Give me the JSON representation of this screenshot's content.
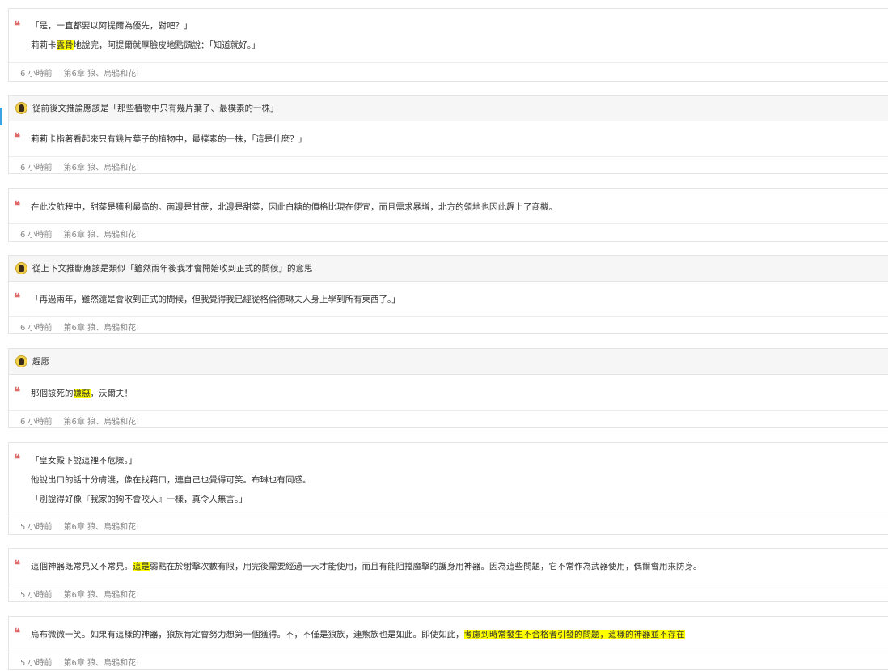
{
  "entries": [
    {
      "lines": [
        [
          {
            "t": "「是，一直都要以阿提爾為優先，對吧？」"
          }
        ],
        [
          {
            "t": "莉莉卡"
          },
          {
            "t": "露骨",
            "hl": true
          },
          {
            "t": "地說完，阿提爾就厚臉皮地點頭說：「知道就好。」"
          }
        ]
      ],
      "time": "6 小時前",
      "chapter": "第6章 狼、烏鴉和花I"
    },
    {
      "note": "從前後文推論應該是「那些植物中只有幾片葉子、最樸素的一株」",
      "lines": [
        [
          {
            "t": "莉莉卡指著看起來只有幾片葉子的植物中，最樸素的一株，「這是什麼？」"
          }
        ]
      ],
      "time": "6 小時前",
      "chapter": "第6章 狼、烏鴉和花I"
    },
    {
      "lines": [
        [
          {
            "t": "在此次航程中，甜菜是獲利最高的。南邊是甘蔗，北邊是甜菜，因此白糖的價格比現在便宜，而且需求暴增，北方的領地也因此趕上了商機。"
          }
        ]
      ],
      "time": "6 小時前",
      "chapter": "第6章 狼、烏鴉和花I"
    },
    {
      "note": "從上下文推斷應該是類似「雖然兩年後我才會開始收到正式的問候」的意思",
      "lines": [
        [
          {
            "t": "「再過兩年，雖然還是會收到正式的問候，但我覺得我已經從格倫德琳夫人身上學到所有東西了。」"
          }
        ]
      ],
      "time": "6 小時前",
      "chapter": "第6章 狼、烏鴉和花I"
    },
    {
      "note": "趕愿",
      "lines": [
        [
          {
            "t": "那個該死的"
          },
          {
            "t": "嫌惡",
            "hl": true
          },
          {
            "t": "，沃爾夫！"
          }
        ]
      ],
      "time": "6 小時前",
      "chapter": "第6章 狼、烏鴉和花I"
    },
    {
      "lines": [
        [
          {
            "t": "「皇女殿下說這裡不危險。」"
          }
        ],
        [
          {
            "t": "他說出口的話十分膚淺，像在找藉口，連自己也覺得可笑。布琳也有同感。"
          }
        ],
        [
          {
            "t": "「別說得好像『我家的狗不會咬人』一樣，真令人無言。」"
          }
        ]
      ],
      "time": "5 小時前",
      "chapter": "第6章 狼、烏鴉和花I"
    },
    {
      "lines": [
        [
          {
            "t": "這個神器既常見又不常見。"
          },
          {
            "t": "這是",
            "hl": true
          },
          {
            "t": "弱點在於射擊次數有限，用完後需要經過一天才能使用，而且有能阻擋魔擊的護身用神器。因為這些問題，它不常作為武器使用，偶爾會用來防身。"
          }
        ]
      ],
      "time": "5 小時前",
      "chapter": "第6章 狼、烏鴉和花I"
    },
    {
      "lines": [
        [
          {
            "t": "烏布微微一笑。如果有這樣的神器，狼族肯定會努力想第一個獲得。不，不僅是狼族，連熊族也是如此。即使如此，"
          },
          {
            "t": "考慮到時常發生不合格者引發的問題，這樣的神器並不存在",
            "hl": true
          }
        ]
      ],
      "time": "5 小時前",
      "chapter": "第6章 狼、烏鴉和花I"
    }
  ]
}
